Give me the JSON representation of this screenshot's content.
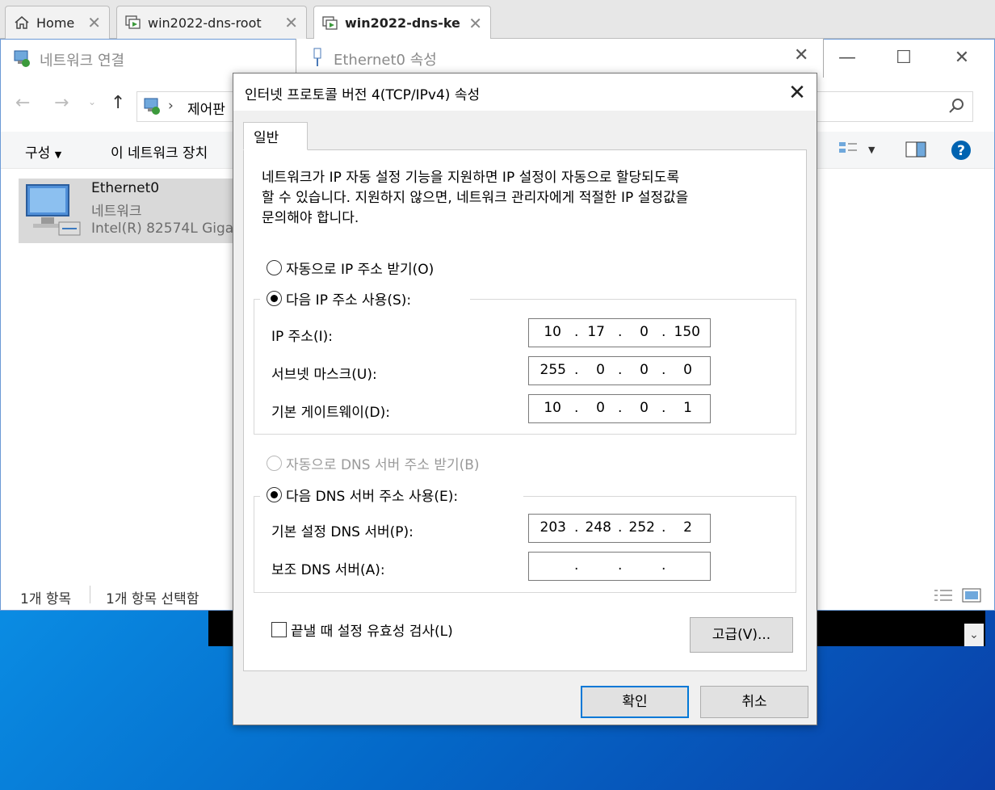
{
  "tabs": [
    {
      "label": "Home"
    },
    {
      "label": "win2022-dns-root"
    },
    {
      "label": "win2022-dns-ke"
    }
  ],
  "explorer": {
    "title": "네트워크 연결",
    "breadcrumb": "제어판",
    "cmd_organize": "구성",
    "cmd_disable": "이 네트워크 장치",
    "item": {
      "name": "Ethernet0",
      "type": "네트워크",
      "adapter": "Intel(R) 82574L Giga"
    },
    "status_count": "1개 항목",
    "status_selected": "1개 항목 선택함"
  },
  "eth_window": {
    "title": "Ethernet0 속성"
  },
  "dialog": {
    "title": "인터넷 프로토콜 버전 4(TCP/IPv4) 속성",
    "tab": "일반",
    "description": [
      "네트워크가 IP 자동 설정 기능을 지원하면 IP 설정이 자동으로 할당되도록",
      "할 수 있습니다. 지원하지 않으면, 네트워크 관리자에게 적절한 IP 설정값을",
      "문의해야 합니다."
    ],
    "radio_auto_ip": "자동으로 IP 주소 받기(O)",
    "radio_manual_ip": "다음 IP 주소 사용(S):",
    "ip_label": "IP 주소(I):",
    "ip_value": [
      "10",
      "17",
      "0",
      "150"
    ],
    "mask_label": "서브넷 마스크(U):",
    "mask_value": [
      "255",
      "0",
      "0",
      "0"
    ],
    "gateway_label": "기본 게이트웨이(D):",
    "gateway_value": [
      "10",
      "0",
      "0",
      "1"
    ],
    "radio_auto_dns": "자동으로 DNS 서버 주소 받기(B)",
    "radio_manual_dns": "다음 DNS 서버 주소 사용(E):",
    "dns1_label": "기본 설정 DNS 서버(P):",
    "dns1_value": [
      "203",
      "248",
      "252",
      "2"
    ],
    "dns2_label": "보조 DNS 서버(A):",
    "dns2_value": [
      "",
      "",
      "",
      ""
    ],
    "validate_label": "끝낼 때 설정 유효성 검사(L)",
    "validate_checked": false,
    "advanced_button": "고급(V)...",
    "ok_button": "확인",
    "cancel_button": "취소"
  },
  "colors": {
    "accent": "#0078d7",
    "help": "#0063b1",
    "vm_icon": "#3c9a3c"
  }
}
